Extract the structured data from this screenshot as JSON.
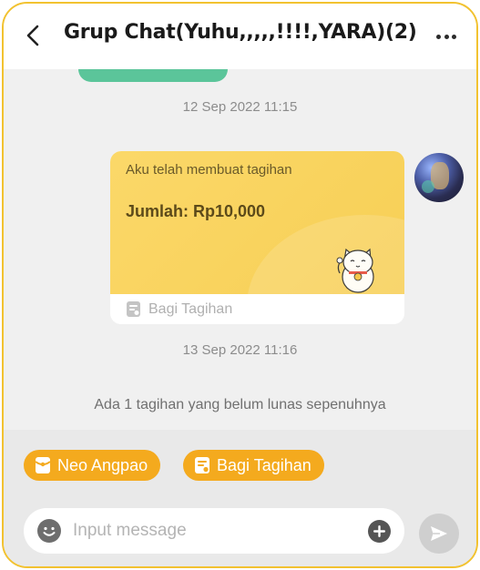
{
  "header": {
    "title": "Grup Chat(Yuhu,,,,,!!!!,YARA)(2)",
    "back_icon": "chevron-left-icon",
    "more_icon": "more-horizontal-icon"
  },
  "chat": {
    "timestamps": [
      "12 Sep 2022 11:15",
      "13 Sep 2022 11:16"
    ],
    "bill_card": {
      "caption": "Aku telah membuat tagihan",
      "amount": "Jumlah: Rp10,000",
      "footer_label": "Bagi Tagihan",
      "colors": {
        "card": "#f9d462",
        "footer_text": "#b0b0b0"
      }
    },
    "notice": "Ada 1 tagihan yang belum lunas sepenuhnya"
  },
  "quick_actions": [
    {
      "label": "Neo Angpao",
      "icon": "red-envelope-icon"
    },
    {
      "label": "Bagi Tagihan",
      "icon": "bill-icon"
    }
  ],
  "composer": {
    "placeholder": "Input message",
    "value": "",
    "icons": {
      "emoji": "emoji-icon",
      "add": "plus-circle-icon",
      "send": "send-icon"
    }
  },
  "colors": {
    "accent": "#f4aa1e",
    "frame_border": "#f2c230",
    "chat_background": "#f0f0f0",
    "panel_background": "#e9e9e9",
    "send_button_disabled": "#cfcfcf"
  }
}
